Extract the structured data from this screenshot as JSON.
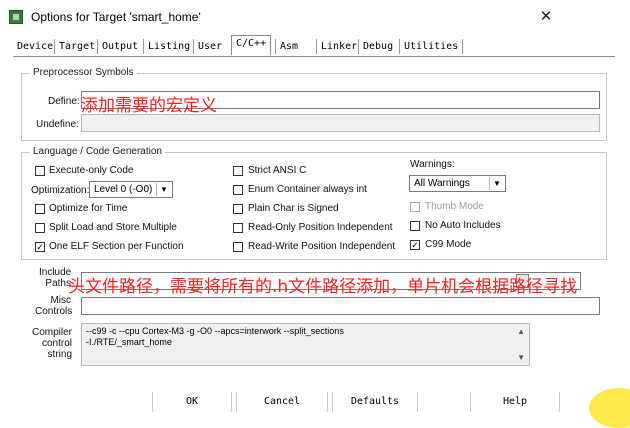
{
  "window": {
    "title": "Options for Target 'smart_home'",
    "close_glyph": "✕",
    "app_icon": "keil-uvision-icon"
  },
  "tabs": [
    {
      "label": "Device"
    },
    {
      "label": "Target"
    },
    {
      "label": "Output"
    },
    {
      "label": "Listing"
    },
    {
      "label": "User"
    },
    {
      "label": "C/C++",
      "active": true
    },
    {
      "label": "Asm"
    },
    {
      "label": "Linker"
    },
    {
      "label": "Debug"
    },
    {
      "label": "Utilities"
    }
  ],
  "preprocessor": {
    "group_title": "Preprocessor Symbols",
    "define_label": "Define:",
    "undefine_label": "Undefine:",
    "define_value": "",
    "undefine_value": ""
  },
  "language": {
    "group_title": "Language / Code Generation",
    "checkboxes_col1": [
      {
        "label": "Execute-only Code",
        "checked": false
      },
      {
        "label": "Optimize for Time",
        "checked": false
      },
      {
        "label": "Split Load and Store Multiple",
        "checked": false
      },
      {
        "label": "One ELF Section per Function",
        "checked": true
      }
    ],
    "optimization_label": "Optimization:",
    "optimization_value": "Level 0 (-O0)",
    "checkboxes_col2": [
      {
        "label": "Strict ANSI C",
        "checked": false
      },
      {
        "label": "Enum Container always int",
        "checked": false
      },
      {
        "label": "Plain Char is Signed",
        "checked": false
      },
      {
        "label": "Read-Only Position Independent",
        "checked": false
      },
      {
        "label": "Read-Write Position Independent",
        "checked": false
      }
    ],
    "warnings_label": "Warnings:",
    "warnings_value": "All Warnings",
    "checkboxes_col3": [
      {
        "label": "Thumb Mode",
        "checked": false,
        "disabled": true
      },
      {
        "label": "No Auto Includes",
        "checked": false
      },
      {
        "label": "C99 Mode",
        "checked": true
      }
    ]
  },
  "include": {
    "label_line1": "Include",
    "label_line2": "Paths",
    "value": ""
  },
  "misc": {
    "label_line1": "Misc",
    "label_line2": "Controls",
    "value": ""
  },
  "compiler": {
    "label_line1": "Compiler",
    "label_line2": "control",
    "label_line3": "string",
    "line1": "--c99 -c --cpu Cortex-M3 -g -O0 --apcs=interwork --split_sections",
    "line2": "-I./RTE/_smart_home"
  },
  "annotations": {
    "define_note": "添加需要的宏定义",
    "include_note": "头文件路径，需要将所有的.h文件路径添加，单片机会根据路径寻找"
  },
  "buttons": {
    "ok": "OK",
    "cancel": "Cancel",
    "defaults": "Defaults",
    "help": "Help"
  },
  "colors": {
    "annotation": "#ff2020",
    "checkmark": "#000000"
  }
}
